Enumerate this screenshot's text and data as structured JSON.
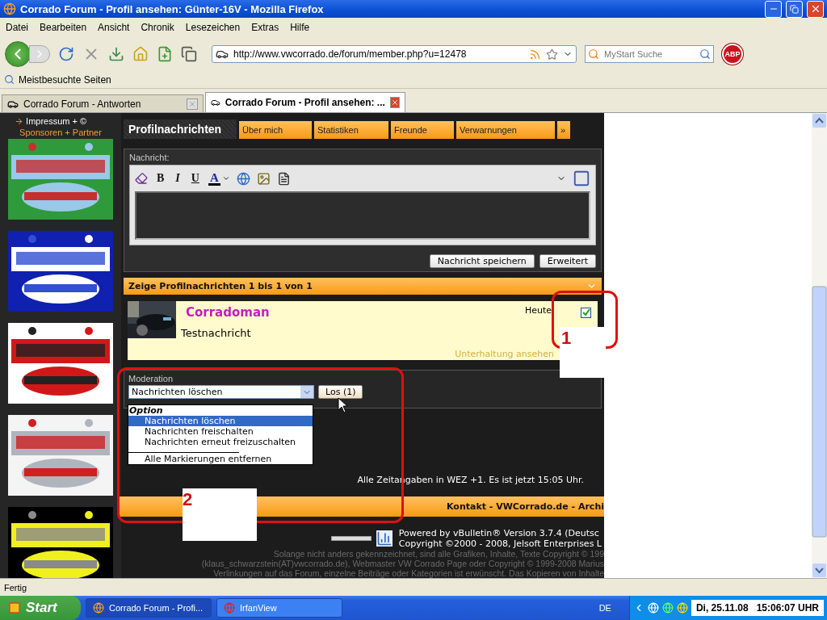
{
  "window": {
    "title": "Corrado Forum - Profil ansehen: Günter-16V - Mozilla Firefox"
  },
  "menu": [
    "Datei",
    "Bearbeiten",
    "Ansicht",
    "Chronik",
    "Lesezeichen",
    "Extras",
    "Hilfe"
  ],
  "toolbar": {
    "url": "http://www.vwcorrado.de/forum/member.php?u=12478",
    "search_placeholder": "MyStart Suche",
    "adblock": "ABP"
  },
  "bookmarks": [
    "Meistbesuchte Seiten"
  ],
  "tabs": [
    {
      "label": "Corrado Forum - Antworten",
      "selected": false
    },
    {
      "label": "Corrado Forum - Profil ansehen: ...",
      "selected": true
    }
  ],
  "sidebar": {
    "link": "Impressum + ©",
    "heading": "Sponsoren + Partner"
  },
  "profile_tabs": [
    {
      "label": "Profilnachrichten",
      "selected": true
    },
    {
      "label": "Über mich",
      "selected": false
    },
    {
      "label": "Statistiken",
      "selected": false
    },
    {
      "label": "Freunde",
      "selected": false
    },
    {
      "label": "Verwarnungen",
      "selected": false
    },
    {
      "label": "»",
      "selected": false
    }
  ],
  "editor": {
    "label": "Nachricht:",
    "format_buttons": [
      "B",
      "I",
      "U"
    ],
    "color_button": "A",
    "buttons": [
      "Nachricht speichern",
      "Erweitert"
    ]
  },
  "messages": {
    "header": "Zeige Profilnachrichten 1 bis 1 von 1",
    "items": [
      {
        "author": "Corradoman",
        "date": "Heute",
        "text": "Testnachricht",
        "link": "Unterhaltung ansehen",
        "checked": true
      }
    ]
  },
  "moderation": {
    "label": "Moderation",
    "value": "Nachrichten löschen",
    "button": "Los (1)",
    "group": "Option",
    "options": [
      {
        "kind": "option",
        "label": "Nachrichten löschen",
        "selected": true
      },
      {
        "kind": "option",
        "label": "Nachrichten freischalten",
        "selected": false
      },
      {
        "kind": "option",
        "label": "Nachrichten erneut freizuschalten",
        "selected": false
      },
      {
        "kind": "separator"
      },
      {
        "kind": "option",
        "label": "Alle Markierungen entfernen",
        "selected": false
      }
    ]
  },
  "timezone": "Alle Zeitangaben in WEZ +1. Es ist jetzt 15:05 Uhr.",
  "footer_bar": "Kontakt - VWCorrado.de - Archi",
  "powered": [
    "Powered by vBulletin® Version 3.7.4 (Deutsc",
    "Copyright ©2000 - 2008, Jelsoft Enterprises L"
  ],
  "copyright": [
    "Solange nicht anders gekennzeichnet, sind alle Grafiken, Inhalte, Texte Copyright © 199",
    "(klaus_schwarzstein(AT)vwcorrado.de), Webmaster VW Corrado Page oder Copyright © 1999-2008 Marius",
    "Verlinkungen auf das Forum, einzelne Beiträge oder Kategorien ist erwünscht. Das Kopieren von Inhalte"
  ],
  "annotations": [
    {
      "label": "1"
    },
    {
      "label": "2"
    }
  ],
  "status_bar": "Fertig",
  "taskbar": {
    "start": "Start",
    "items": [
      {
        "label": "Corrado Forum - Profi...",
        "selected": true
      },
      {
        "label": "IrfanView",
        "selected": false
      }
    ],
    "language": "DE",
    "clock": "Di, 25.11.08   15:06:07 UHR"
  }
}
